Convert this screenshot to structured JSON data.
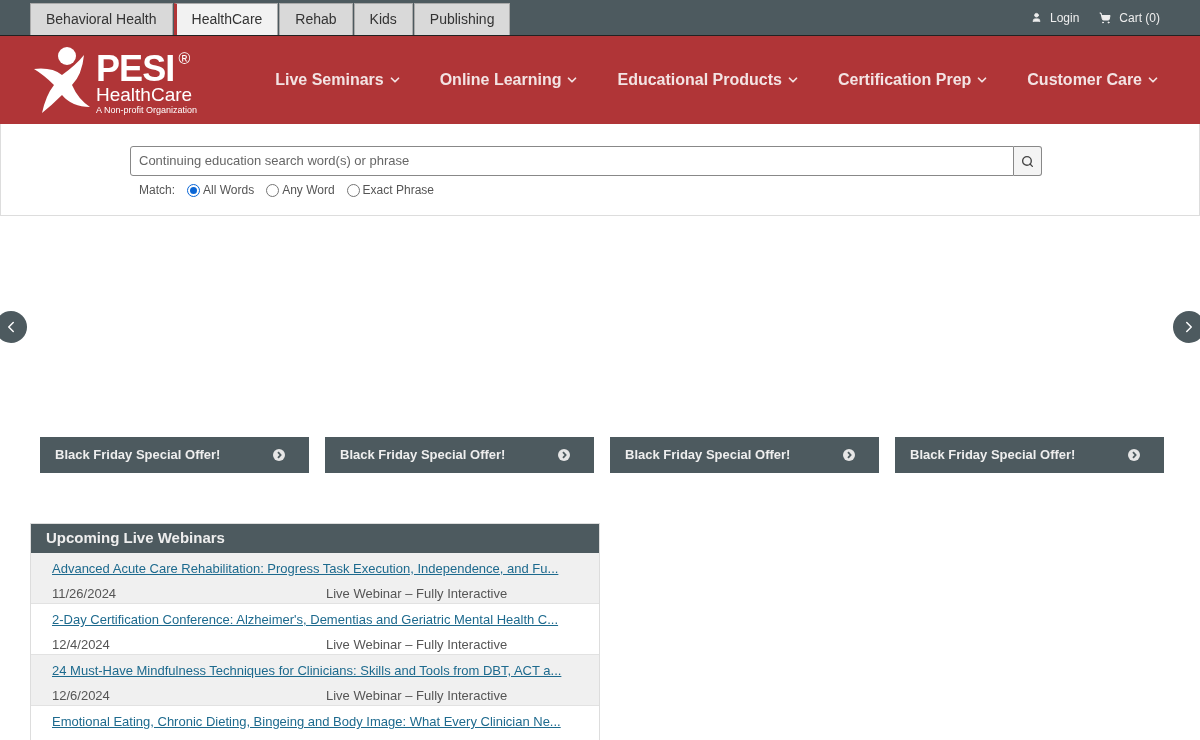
{
  "site_tabs": [
    {
      "label": "Behavioral Health",
      "selected": false
    },
    {
      "label": "HealthCare",
      "selected": true
    },
    {
      "label": "Rehab",
      "selected": false
    },
    {
      "label": "Kids",
      "selected": false
    },
    {
      "label": "Publishing",
      "selected": false
    }
  ],
  "account": {
    "login": "Login",
    "cart": "Cart (0)"
  },
  "logo": {
    "name": "PESI",
    "mark": "®",
    "division": "HealthCare",
    "tagline": "A Non-profit Organization"
  },
  "nav": [
    "Live Seminars",
    "Online Learning",
    "Educational Products",
    "Certification Prep",
    "Customer Care"
  ],
  "search": {
    "placeholder": "Continuing education search word(s) or phrase",
    "match_label": "Match:",
    "options": [
      {
        "label": "All Words",
        "selected": true
      },
      {
        "label": "Any Word",
        "selected": false
      },
      {
        "label": "Exact Phrase",
        "selected": false
      }
    ]
  },
  "offers": [
    "Black Friday Special Offer!",
    "Black Friday Special Offer!",
    "Black Friday Special Offer!",
    "Black Friday Special Offer!"
  ],
  "webinars": {
    "title": "Upcoming Live Webinars",
    "rows": [
      {
        "title": "Advanced Acute Care Rehabilitation: Progress Task Execution, Independence, and Fu...",
        "date": "11/26/2024",
        "format": "Live Webinar – Fully Interactive"
      },
      {
        "title": "2-Day Certification Conference: Alzheimer's, Dementias and Geriatric Mental Health C...",
        "date": "12/4/2024",
        "format": "Live Webinar – Fully Interactive"
      },
      {
        "title": "24 Must-Have Mindfulness Techniques for Clinicians: Skills and Tools from DBT, ACT a...",
        "date": "12/6/2024",
        "format": "Live Webinar – Fully Interactive"
      },
      {
        "title": "Emotional Eating, Chronic Dieting, Bingeing and Body Image: What Every Clinician Ne..."
      }
    ]
  }
}
